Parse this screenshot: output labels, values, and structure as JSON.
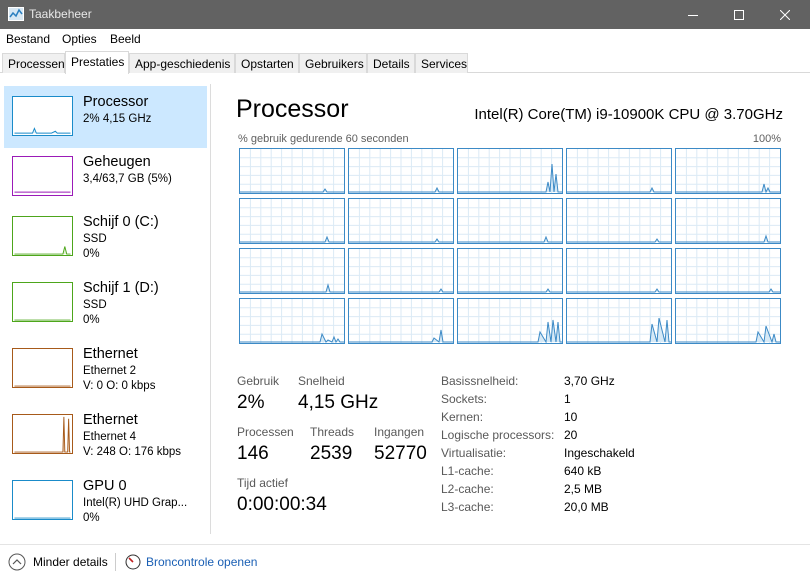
{
  "window": {
    "title": "Taakbeheer"
  },
  "menu": [
    "Bestand",
    "Opties",
    "Beeld"
  ],
  "tabs": [
    "Processen",
    "Prestaties",
    "App-geschiedenis",
    "Opstarten",
    "Gebruikers",
    "Details",
    "Services"
  ],
  "active_tab": "Prestaties",
  "sidebar": [
    {
      "name": "Processor",
      "line2": "2% 4,15 GHz",
      "line3": "",
      "color": "#1a8bc9"
    },
    {
      "name": "Geheugen",
      "line2": "3,4/63,7 GB (5%)",
      "line3": "",
      "color": "#9b1ab8"
    },
    {
      "name": "Schijf 0 (C:)",
      "line2": "SSD",
      "line3": "0%",
      "color": "#4da61b"
    },
    {
      "name": "Schijf 1 (D:)",
      "line2": "SSD",
      "line3": "0%",
      "color": "#4da61b"
    },
    {
      "name": "Ethernet",
      "line2": "Ethernet 2",
      "line3_pre": "V: 0  O: 0 kbps",
      "color": "#a75a1a"
    },
    {
      "name": "Ethernet",
      "line2": "Ethernet 4",
      "line3_pre": "V: 248  O: 176 kbps",
      "color": "#a75a1a"
    },
    {
      "name": "GPU 0",
      "line2": "Intel(R) UHD Grap...",
      "line3": "0%",
      "color": "#1a8bc9"
    }
  ],
  "main": {
    "title": "Processor",
    "cpu_name": "Intel(R) Core(TM) i9-10900K CPU @ 3.70GHz",
    "graph_label": "% gebruik gedurende 60 seconden",
    "graph_max": "100%",
    "accent": "#3c8ac6"
  },
  "stats": {
    "gebruik_label": "Gebruik",
    "gebruik": "2%",
    "snelheid_label": "Snelheid",
    "snelheid": "4,15 GHz",
    "processen_label": "Processen",
    "processen": "146",
    "threads_label": "Threads",
    "threads": "2539",
    "ingangen_label": "Ingangen",
    "ingangen": "52770",
    "tijd_label": "Tijd actief",
    "tijd": "0:00:00:34"
  },
  "info": [
    {
      "label": "Basissnelheid:",
      "value": "3,70 GHz"
    },
    {
      "label": "Sockets:",
      "value": "1"
    },
    {
      "label": "Kernen:",
      "value": "10"
    },
    {
      "label": "Logische processors:",
      "value": "20"
    },
    {
      "label": "Virtualisatie:",
      "value": "Ingeschakeld"
    },
    {
      "label": "L1-cache:",
      "value": "640 kB"
    },
    {
      "label": "L2-cache:",
      "value": "2,5 MB"
    },
    {
      "label": "L3-cache:",
      "value": "20,0 MB"
    }
  ],
  "footer": {
    "less_details": "Minder details",
    "resource_monitor": "Broncontrole openen"
  }
}
